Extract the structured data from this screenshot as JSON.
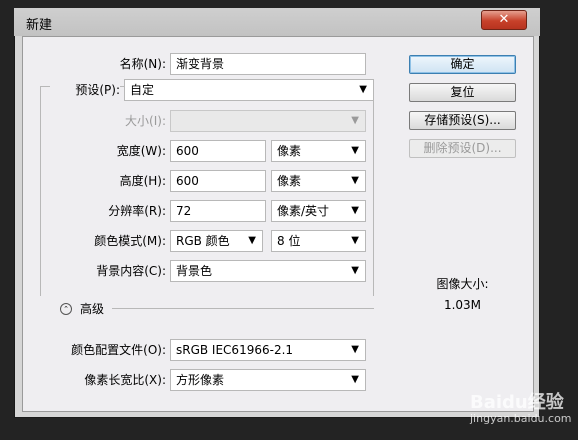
{
  "window": {
    "title": "新建",
    "close": "✕"
  },
  "form": {
    "name": {
      "label": "名称(N):",
      "value": "渐变背景"
    },
    "preset": {
      "label": "预设(P):",
      "value": "自定"
    },
    "size": {
      "label": "大小(I):",
      "value": ""
    },
    "width": {
      "label": "宽度(W):",
      "value": "600",
      "unit": "像素"
    },
    "height": {
      "label": "高度(H):",
      "value": "600",
      "unit": "像素"
    },
    "resolution": {
      "label": "分辨率(R):",
      "value": "72",
      "unit": "像素/英寸"
    },
    "color_mode": {
      "label": "颜色模式(M):",
      "value": "RGB 颜色",
      "depth": "8 位"
    },
    "background": {
      "label": "背景内容(C):",
      "value": "背景色"
    },
    "advanced": {
      "label": "高级"
    },
    "color_profile": {
      "label": "颜色配置文件(O):",
      "value": "sRGB IEC61966-2.1"
    },
    "pixel_aspect": {
      "label": "像素长宽比(X):",
      "value": "方形像素"
    }
  },
  "buttons": {
    "ok": "确定",
    "reset": "复位",
    "save_preset": "存储预设(S)...",
    "delete_preset": "删除预设(D)..."
  },
  "image_size": {
    "label": "图像大小:",
    "value": "1.03M"
  },
  "watermark": {
    "text": "Baidu经验",
    "url": "jingyan.baidu.com"
  }
}
